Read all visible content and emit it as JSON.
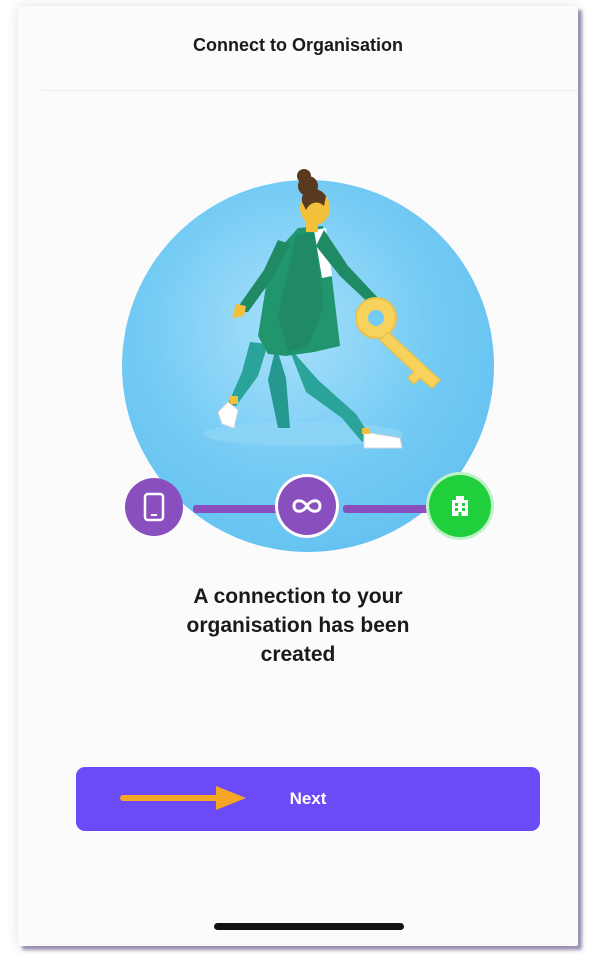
{
  "header": {
    "title": "Connect to Organisation"
  },
  "main": {
    "message": "A connection to your\norganisation has been\ncreated"
  },
  "actions": {
    "next_label": "Next"
  },
  "progress_steps": [
    {
      "name": "device",
      "icon": "tablet-icon",
      "color": "#8a4fbf",
      "state": "complete"
    },
    {
      "name": "link",
      "icon": "infinity-icon",
      "color": "#8a4fbf",
      "state": "complete"
    },
    {
      "name": "organisation",
      "icon": "building-icon",
      "color": "#1fcf3c",
      "state": "active"
    }
  ],
  "colors": {
    "accent": "#6b4bf7",
    "circle": "#6ec8f4",
    "step_purple": "#8a4fbf",
    "step_green": "#1fcf3c",
    "annotation_arrow": "#f5a623"
  }
}
